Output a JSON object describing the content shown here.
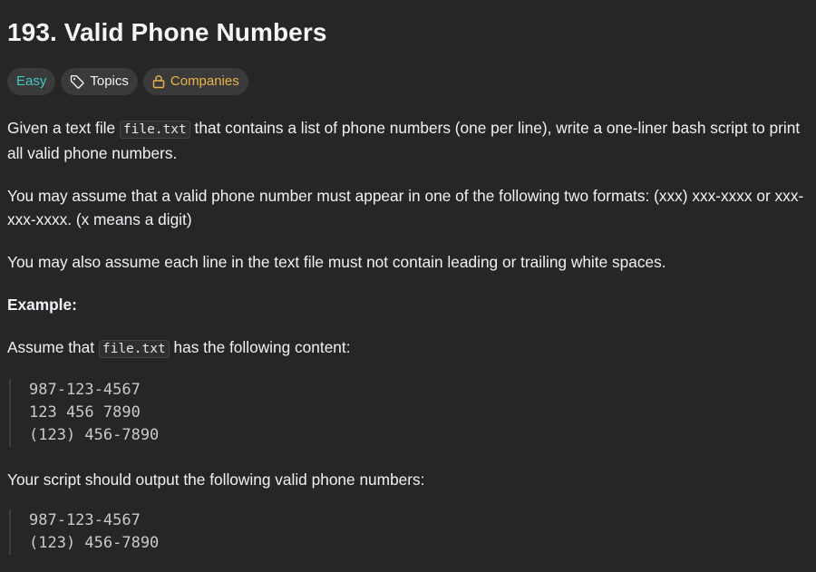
{
  "problem": {
    "title": "193. Valid Phone Numbers"
  },
  "tags": {
    "difficulty": "Easy",
    "topics": "Topics",
    "companies": "Companies"
  },
  "description": {
    "p1_before": "Given a text file ",
    "p1_code": "file.txt",
    "p1_after": " that contains a list of phone numbers (one per line), write a one-liner bash script to print all valid phone numbers.",
    "p2": "You may assume that a valid phone number must appear in one of the following two formats: (xxx) xxx-xxxx or xxx-xxx-xxxx. (x means a digit)",
    "p3": "You may also assume each line in the text file must not contain leading or trailing white spaces.",
    "example_label": "Example:",
    "p4_before": "Assume that ",
    "p4_code": "file.txt",
    "p4_after": " has the following content:",
    "input_lines": [
      "987-123-4567",
      "123 456 7890",
      "(123) 456-7890"
    ],
    "p5": "Your script should output the following valid phone numbers:",
    "output_lines": [
      "987-123-4567",
      "(123) 456-7890"
    ]
  },
  "icons": {
    "topics": "tag-icon",
    "companies": "lock-icon"
  },
  "colors": {
    "background": "#262626",
    "easy": "#46c6c2",
    "companies": "#e8b34a",
    "text": "#eff1f6"
  }
}
